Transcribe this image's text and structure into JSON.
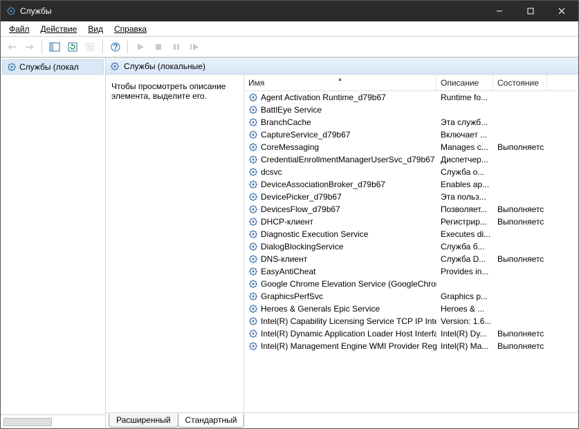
{
  "window": {
    "title": "Службы"
  },
  "menu": {
    "file": "Файл",
    "action": "Действие",
    "view": "Вид",
    "help": "Справка"
  },
  "nav": {
    "root": "Службы (локал"
  },
  "detail": {
    "header": "Службы (локальные)",
    "placeholder": "Чтобы просмотреть описание элемента, выделите его."
  },
  "columns": {
    "name": "Имя",
    "desc": "Описание",
    "state": "Состояние"
  },
  "tabs": {
    "extended": "Расширенный",
    "standard": "Стандартный"
  },
  "services": [
    {
      "name": "Agent Activation Runtime_d79b67",
      "desc": "Runtime fo...",
      "state": ""
    },
    {
      "name": "BattlEye Service",
      "desc": "",
      "state": ""
    },
    {
      "name": "BranchCache",
      "desc": "Эта служб...",
      "state": ""
    },
    {
      "name": "CaptureService_d79b67",
      "desc": "Включает ...",
      "state": ""
    },
    {
      "name": "CoreMessaging",
      "desc": "Manages c...",
      "state": "Выполняетс"
    },
    {
      "name": "CredentialEnrollmentManagerUserSvc_d79b67",
      "desc": "Диспетчер...",
      "state": ""
    },
    {
      "name": "dcsvc",
      "desc": "Служба о...",
      "state": ""
    },
    {
      "name": "DeviceAssociationBroker_d79b67",
      "desc": "Enables ap...",
      "state": ""
    },
    {
      "name": "DevicePicker_d79b67",
      "desc": "Эта польз...",
      "state": ""
    },
    {
      "name": "DevicesFlow_d79b67",
      "desc": "Позволяет...",
      "state": "Выполняетс"
    },
    {
      "name": "DHCP-клиент",
      "desc": "Регистрир...",
      "state": "Выполняетс"
    },
    {
      "name": "Diagnostic Execution Service",
      "desc": "Executes di...",
      "state": ""
    },
    {
      "name": "DialogBlockingService",
      "desc": "Служба б...",
      "state": ""
    },
    {
      "name": "DNS-клиент",
      "desc": "Служба D...",
      "state": "Выполняетс"
    },
    {
      "name": "EasyAntiCheat",
      "desc": "Provides in...",
      "state": ""
    },
    {
      "name": "Google Chrome Elevation Service (GoogleChrom...",
      "desc": "",
      "state": ""
    },
    {
      "name": "GraphicsPerfSvc",
      "desc": "Graphics p...",
      "state": ""
    },
    {
      "name": "Heroes & Generals Epic Service",
      "desc": "Heroes & ...",
      "state": ""
    },
    {
      "name": "Intel(R) Capability Licensing Service TCP IP Interfa...",
      "desc": "Version: 1.6...",
      "state": ""
    },
    {
      "name": "Intel(R) Dynamic Application Loader Host Interfa...",
      "desc": "Intel(R) Dy...",
      "state": "Выполняетс"
    },
    {
      "name": "Intel(R) Management Engine WMI Provider Regis...",
      "desc": "Intel(R) Ma...",
      "state": "Выполняетс"
    }
  ]
}
